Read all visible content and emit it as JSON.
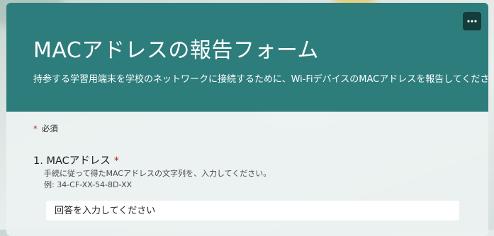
{
  "form": {
    "title": "MACアドレスの報告フォーム",
    "description": "持参する学習用端末を学校のネットワークに接続するために、Wi-FiデバイスのMACアドレスを報告してください。",
    "menu_icon": "more-horizontal-icon",
    "required_note": {
      "asterisk": "*",
      "label": "必須"
    }
  },
  "question1": {
    "title": "1. MACアドレス",
    "required_mark": "*",
    "description_line1": "手続に従って得たMACアドレスの文字列を、入力してください。",
    "description_line2": "例: 34-CF-XX-54-8D-XX",
    "placeholder": "回答を入力してください"
  },
  "colors": {
    "header": "#2e7d7d",
    "menu_button": "#143c3a",
    "required": "#b3261e"
  }
}
